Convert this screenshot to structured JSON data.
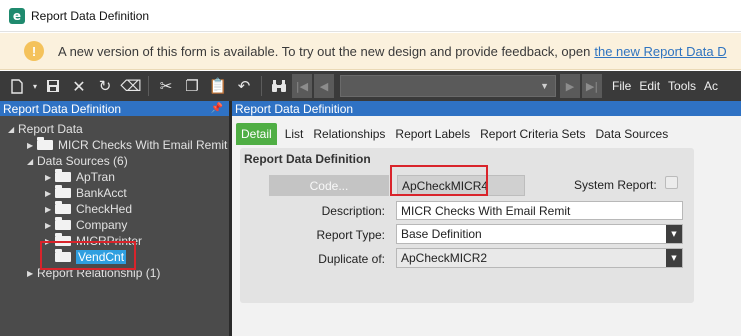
{
  "window": {
    "title": "Report Data Definition",
    "app_icon_letter": "e"
  },
  "banner": {
    "icon": "!",
    "message": "A new version of this form is available. To try out the new design and provide feedback, open",
    "link": "the new Report Data D"
  },
  "toolbar": {
    "icons": [
      "new-icon",
      "save-icon",
      "delete-icon",
      "refresh-icon",
      "clear-icon",
      "cut-icon",
      "copy-icon",
      "paste-icon",
      "undo-icon",
      "binoculars-icon"
    ],
    "menus": [
      "File",
      "Edit",
      "Tools",
      "Ac"
    ]
  },
  "tree": {
    "header": "Report Data Definition",
    "root": "Report Data",
    "report_item": "MICR Checks With Email Remit",
    "data_sources": "Data Sources (6)",
    "sources": [
      "ApTran",
      "BankAcct",
      "CheckHed",
      "Company",
      "MICRPrinter"
    ],
    "selected": "VendCnt",
    "relationships": "Report Relationship (1)"
  },
  "detail": {
    "header": "Report Data Definition",
    "tabs": [
      "Detail",
      "List",
      "Relationships",
      "Report Labels",
      "Report Criteria Sets",
      "Data Sources"
    ],
    "section_title": "Report Data Definition",
    "code_button": "Code...",
    "code_value": "ApCheckMICR4",
    "system_report_label": "System Report:",
    "description_label": "Description:",
    "description_value": "MICR Checks With Email Remit",
    "report_type_label": "Report Type:",
    "report_type_value": "Base Definition",
    "duplicate_of_label": "Duplicate of:",
    "duplicate_of_value": "ApCheckMICR2"
  }
}
